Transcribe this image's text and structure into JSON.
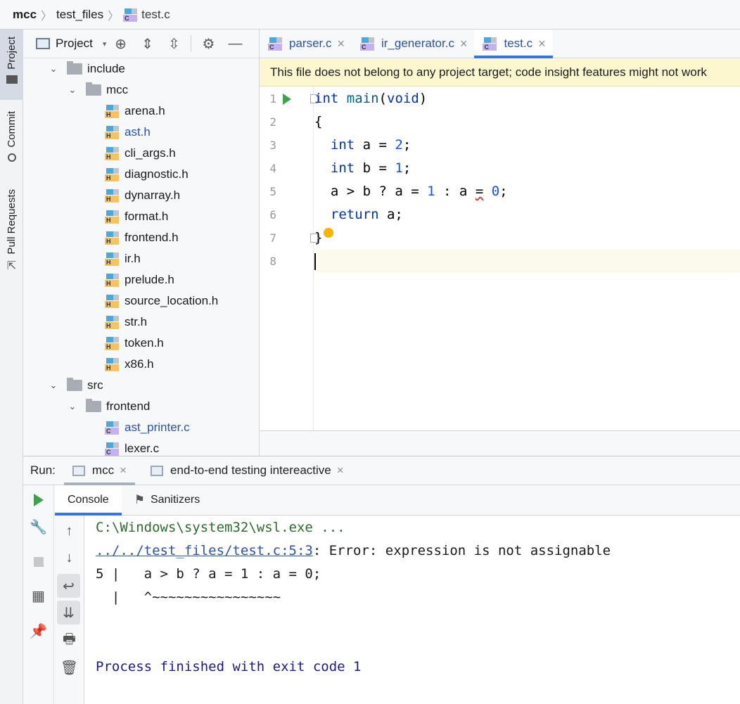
{
  "breadcrumb": {
    "project": "mcc",
    "folder": "test_files",
    "file": "test.c"
  },
  "left_strip": {
    "project": "Project",
    "commit": "Commit",
    "pull_requests": "Pull Requests"
  },
  "project_panel": {
    "title": "Project",
    "tree": [
      {
        "label": "include",
        "type": "folder",
        "indent": 0
      },
      {
        "label": "mcc",
        "type": "folder",
        "indent": 1
      },
      {
        "label": "arena.h",
        "type": "h",
        "indent": 2
      },
      {
        "label": "ast.h",
        "type": "h",
        "indent": 2,
        "modified": true
      },
      {
        "label": "cli_args.h",
        "type": "h",
        "indent": 2
      },
      {
        "label": "diagnostic.h",
        "type": "h",
        "indent": 2
      },
      {
        "label": "dynarray.h",
        "type": "h",
        "indent": 2
      },
      {
        "label": "format.h",
        "type": "h",
        "indent": 2
      },
      {
        "label": "frontend.h",
        "type": "h",
        "indent": 2
      },
      {
        "label": "ir.h",
        "type": "h",
        "indent": 2
      },
      {
        "label": "prelude.h",
        "type": "h",
        "indent": 2
      },
      {
        "label": "source_location.h",
        "type": "h",
        "indent": 2
      },
      {
        "label": "str.h",
        "type": "h",
        "indent": 2
      },
      {
        "label": "token.h",
        "type": "h",
        "indent": 2
      },
      {
        "label": "x86.h",
        "type": "h",
        "indent": 2
      },
      {
        "label": "src",
        "type": "folder",
        "indent": 0
      },
      {
        "label": "frontend",
        "type": "folder",
        "indent": 1
      },
      {
        "label": "ast_printer.c",
        "type": "c",
        "indent": 2,
        "modified": true
      },
      {
        "label": "lexer.c",
        "type": "c",
        "indent": 2
      }
    ]
  },
  "editor": {
    "tabs": [
      {
        "label": "parser.c",
        "active": false
      },
      {
        "label": "ir_generator.c",
        "active": false
      },
      {
        "label": "test.c",
        "active": true
      }
    ],
    "warning": "This file does not belong to any project target; code insight features might not work",
    "line_numbers": [
      "1",
      "2",
      "3",
      "4",
      "5",
      "6",
      "7",
      "8"
    ]
  },
  "run": {
    "label": "Run:",
    "tabs": [
      {
        "label": "mcc",
        "active": true
      },
      {
        "label": "end-to-end testing intereactive",
        "active": false
      }
    ],
    "console_tabs": {
      "console": "Console",
      "sanitizers": "Sanitizers"
    },
    "output": {
      "cmd": "C:\\Windows\\system32\\wsl.exe ...",
      "error_link": "../../test_files/test.c:5:3",
      "error_msg": ": Error: expression is not assignable",
      "source_line": "5 |   a > b ? a = 1 : a = 0;",
      "caret_line": "  |   ^~~~~~~~~~~~~~~~~",
      "exit": "Process finished with exit code 1"
    }
  },
  "colors": {
    "accent": "#3574f0",
    "keyword": "#0033b3",
    "number": "#1750eb",
    "warning_bg": "#fdf7cf"
  }
}
